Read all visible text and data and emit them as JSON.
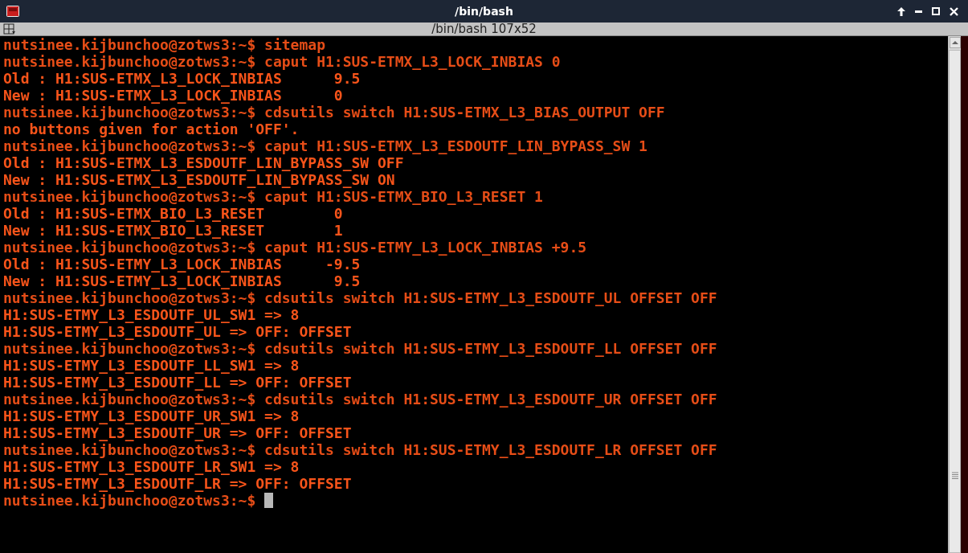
{
  "window": {
    "title": "/bin/bash"
  },
  "tab": {
    "title": "/bin/bash 107x52"
  },
  "terminal": {
    "cursor_visible": true,
    "lines": [
      {
        "kind": "prompt",
        "text": "nutsinee.kijbunchoo@zotws3:~$ sitemap"
      },
      {
        "kind": "prompt",
        "text": "nutsinee.kijbunchoo@zotws3:~$ caput H1:SUS-ETMX_L3_LOCK_INBIAS 0"
      },
      {
        "kind": "output",
        "text": "Old : H1:SUS-ETMX_L3_LOCK_INBIAS      9.5"
      },
      {
        "kind": "output",
        "text": "New : H1:SUS-ETMX_L3_LOCK_INBIAS      0"
      },
      {
        "kind": "prompt",
        "text": "nutsinee.kijbunchoo@zotws3:~$ cdsutils switch H1:SUS-ETMX_L3_BIAS_OUTPUT OFF"
      },
      {
        "kind": "output",
        "text": "no buttons given for action 'OFF'."
      },
      {
        "kind": "prompt",
        "text": "nutsinee.kijbunchoo@zotws3:~$ caput H1:SUS-ETMX_L3_ESDOUTF_LIN_BYPASS_SW 1"
      },
      {
        "kind": "output",
        "text": "Old : H1:SUS-ETMX_L3_ESDOUTF_LIN_BYPASS_SW OFF"
      },
      {
        "kind": "output",
        "text": "New : H1:SUS-ETMX_L3_ESDOUTF_LIN_BYPASS_SW ON"
      },
      {
        "kind": "prompt",
        "text": "nutsinee.kijbunchoo@zotws3:~$ caput H1:SUS-ETMX_BIO_L3_RESET 1"
      },
      {
        "kind": "output",
        "text": "Old : H1:SUS-ETMX_BIO_L3_RESET        0"
      },
      {
        "kind": "output",
        "text": "New : H1:SUS-ETMX_BIO_L3_RESET        1"
      },
      {
        "kind": "prompt",
        "text": "nutsinee.kijbunchoo@zotws3:~$ caput H1:SUS-ETMY_L3_LOCK_INBIAS +9.5"
      },
      {
        "kind": "output",
        "text": "Old : H1:SUS-ETMY_L3_LOCK_INBIAS     -9.5"
      },
      {
        "kind": "output",
        "text": "New : H1:SUS-ETMY_L3_LOCK_INBIAS      9.5"
      },
      {
        "kind": "prompt",
        "text": "nutsinee.kijbunchoo@zotws3:~$ cdsutils switch H1:SUS-ETMY_L3_ESDOUTF_UL OFFSET OFF"
      },
      {
        "kind": "output",
        "text": "H1:SUS-ETMY_L3_ESDOUTF_UL_SW1 => 8"
      },
      {
        "kind": "output",
        "text": "H1:SUS-ETMY_L3_ESDOUTF_UL => OFF: OFFSET"
      },
      {
        "kind": "prompt",
        "text": "nutsinee.kijbunchoo@zotws3:~$ cdsutils switch H1:SUS-ETMY_L3_ESDOUTF_LL OFFSET OFF"
      },
      {
        "kind": "output",
        "text": "H1:SUS-ETMY_L3_ESDOUTF_LL_SW1 => 8"
      },
      {
        "kind": "output",
        "text": "H1:SUS-ETMY_L3_ESDOUTF_LL => OFF: OFFSET"
      },
      {
        "kind": "prompt",
        "text": "nutsinee.kijbunchoo@zotws3:~$ cdsutils switch H1:SUS-ETMY_L3_ESDOUTF_UR OFFSET OFF"
      },
      {
        "kind": "output",
        "text": "H1:SUS-ETMY_L3_ESDOUTF_UR_SW1 => 8"
      },
      {
        "kind": "output",
        "text": "H1:SUS-ETMY_L3_ESDOUTF_UR => OFF: OFFSET"
      },
      {
        "kind": "prompt",
        "text": "nutsinee.kijbunchoo@zotws3:~$ cdsutils switch H1:SUS-ETMY_L3_ESDOUTF_LR OFFSET OFF"
      },
      {
        "kind": "output",
        "text": "H1:SUS-ETMY_L3_ESDOUTF_LR_SW1 => 8"
      },
      {
        "kind": "output",
        "text": "H1:SUS-ETMY_L3_ESDOUTF_LR => OFF: OFFSET"
      },
      {
        "kind": "prompt",
        "text": "nutsinee.kijbunchoo@zotws3:~$"
      }
    ]
  }
}
